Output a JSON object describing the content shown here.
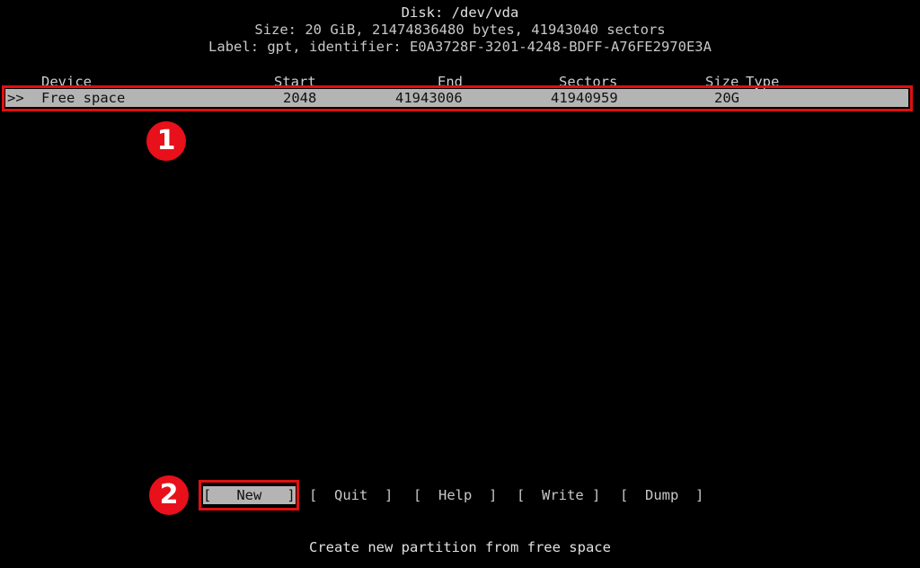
{
  "disk": {
    "title": "Disk: /dev/vda",
    "size_line": "Size: 20 GiB, 21474836480 bytes, 41943040 sectors",
    "label_line": "Label: gpt, identifier: E0A3728F-3201-4248-BDFF-A76FE2970E3A"
  },
  "table": {
    "headers": {
      "device": "Device",
      "start": "Start",
      "end": "End",
      "sectors": "Sectors",
      "size": "Size",
      "type": "Type"
    },
    "rows": [
      {
        "cursor": ">>",
        "device": "Free space",
        "start": "2048",
        "end": "41943006",
        "sectors": "41940959",
        "size": "20G",
        "type": ""
      }
    ]
  },
  "menu": {
    "buttons": [
      {
        "label": "[   New   ]",
        "selected": true
      },
      {
        "label": "[  Quit  ]"
      },
      {
        "label": "[  Help  ]"
      },
      {
        "label": "[  Write ]"
      },
      {
        "label": "[  Dump  ]"
      }
    ]
  },
  "hint": "Create new partition from free space",
  "annotations": {
    "badge1": "1",
    "badge2": "2",
    "color": "#e01010"
  }
}
